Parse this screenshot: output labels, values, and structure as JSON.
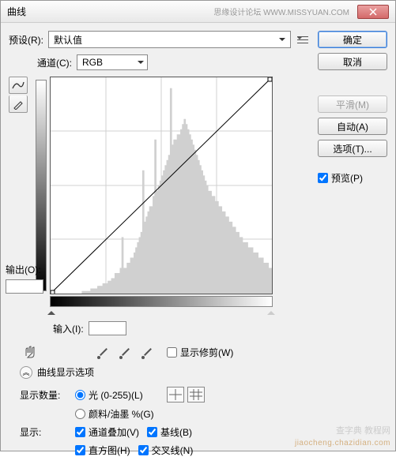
{
  "title": "曲线",
  "watermark_top": "思缘设计论坛  WWW.MISSYUAN.COM",
  "preset": {
    "label": "预设(R):",
    "value": "默认值"
  },
  "channel": {
    "label": "通道(C):",
    "value": "RGB"
  },
  "output_label": "输出(O):",
  "input_label": "输入(I):",
  "show_clip": "显示修剪(W)",
  "expand_title": "曲线显示选项",
  "show_amount": {
    "label": "显示数量:",
    "opt_light": "光 (0-255)(L)",
    "opt_pigment": "颜料/油墨 %(G)"
  },
  "show": {
    "label": "显示:",
    "overlay": "通道叠加(V)",
    "baseline": "基线(B)",
    "histogram": "直方图(H)",
    "intersection": "交叉线(N)"
  },
  "buttons": {
    "ok": "确定",
    "cancel": "取消",
    "smooth": "平滑(M)",
    "auto": "自动(A)",
    "options": "选项(T)...",
    "preview": "预览(P)"
  },
  "watermark_mid": "查字典 教程网",
  "watermark_bottom": "jiaocheng.chazidian.com",
  "chart_data": {
    "type": "curve_histogram",
    "title": "",
    "x_range": [
      0,
      255
    ],
    "y_range": [
      0,
      255
    ],
    "grid_divisions": 4,
    "curve_points": [
      [
        0,
        0
      ],
      [
        255,
        255
      ]
    ],
    "histogram": [
      0,
      0,
      0,
      0,
      0,
      0,
      0,
      0,
      0,
      0,
      0,
      0,
      0,
      0,
      0,
      0,
      0,
      0,
      1,
      1,
      1,
      1,
      1,
      2,
      2,
      2,
      2,
      3,
      3,
      3,
      4,
      4,
      4,
      5,
      5,
      6,
      6,
      8,
      8,
      8,
      10,
      22,
      10,
      10,
      12,
      12,
      14,
      14,
      16,
      18,
      20,
      22,
      24,
      48,
      28,
      30,
      32,
      34,
      34,
      38,
      60,
      40,
      42,
      44,
      46,
      48,
      50,
      52,
      54,
      80,
      58,
      60,
      60,
      62,
      62,
      64,
      66,
      68,
      66,
      64,
      62,
      60,
      58,
      56,
      54,
      52,
      50,
      48,
      46,
      44,
      42,
      40,
      40,
      38,
      38,
      36,
      36,
      34,
      34,
      32,
      32,
      30,
      30,
      28,
      28,
      26,
      26,
      24,
      24,
      22,
      22,
      20,
      20,
      20,
      18,
      18,
      18,
      16,
      16,
      16,
      14,
      14,
      14,
      12,
      12,
      12,
      10,
      10
    ]
  }
}
